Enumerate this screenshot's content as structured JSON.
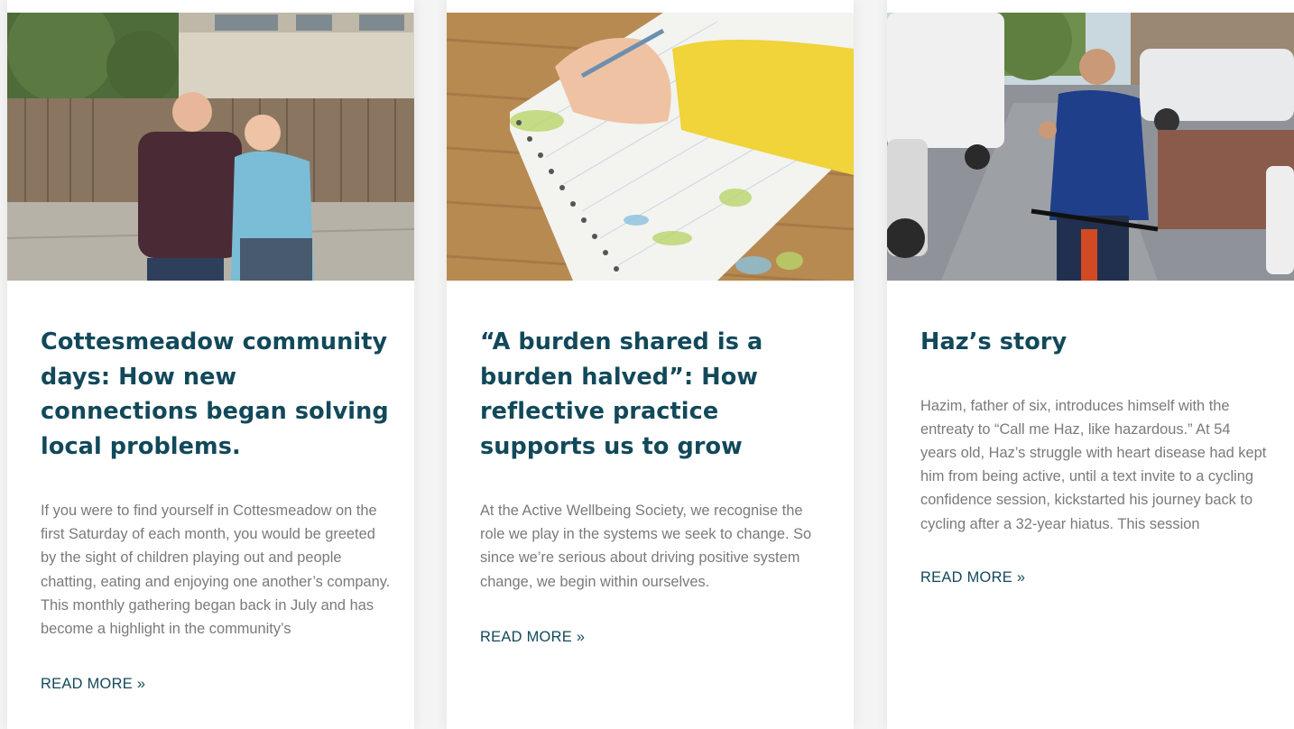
{
  "posts": [
    {
      "image_alt": "Two people standing together on a paved street in front of a wooden fence",
      "title": "Cottesmeadow community days: How new connections began solving local problems.",
      "excerpt": "If you were to find yourself in Cottesmeadow on the first Saturday of each month, you would be greeted by the sight of children playing out and people chatting, eating and enjoying one another’s company. This monthly gathering began back in July and has become a highlight in the community’s",
      "read_more": "READ MORE »"
    },
    {
      "image_alt": "A hand in a yellow sleeve writing with a pen in a spiral notebook on a wooden table",
      "title": "“A burden shared is a burden halved”: How reflective practice supports us to grow",
      "excerpt": "At the Active Wellbeing Society, we recognise the role we play in the systems we seek to change. So since we’re serious about driving positive system change, we begin within ourselves.",
      "read_more": "READ MORE »"
    },
    {
      "image_alt": "A man on a bicycle giving a thumbs up on a residential street",
      "title": "Haz’s story",
      "excerpt": "Hazim, father of six, introduces himself with the entreaty to “Call me Haz, like hazardous.” At 54 years old, Haz’s struggle with heart disease had kept him from being active, until a text invite to a cycling confidence session, kickstarted his journey back to cycling after a 32-year hiatus. This session",
      "read_more": "READ MORE »"
    }
  ],
  "colors": {
    "title": "#12495a",
    "excerpt": "#7a7a7a",
    "card_bg": "#ffffff",
    "page_bg": "#f4f4f4"
  }
}
